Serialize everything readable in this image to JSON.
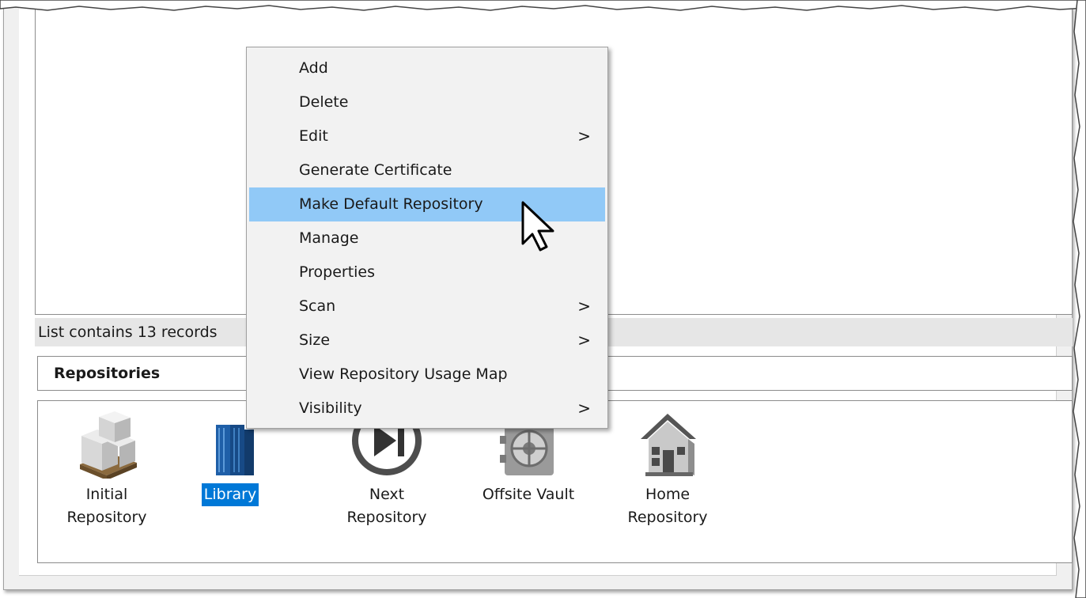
{
  "status_bar": {
    "text": "List contains 13 records"
  },
  "repositories": {
    "header": "Repositories",
    "items": [
      {
        "label": "Initial\nRepository",
        "icon": "boxes-pallet-icon",
        "selected": false
      },
      {
        "label": "Library",
        "icon": "server-rack-icon",
        "selected": true
      },
      {
        "label": "Next Repository",
        "icon": "next-track-icon",
        "selected": false
      },
      {
        "label": "Offsite Vault",
        "icon": "vault-icon",
        "selected": false
      },
      {
        "label": "Home\nRepository",
        "icon": "house-icon",
        "selected": false
      }
    ]
  },
  "context_menu": {
    "items": [
      {
        "label": "Add",
        "submenu": false
      },
      {
        "label": "Delete",
        "submenu": false
      },
      {
        "label": "Edit",
        "submenu": true
      },
      {
        "label": "Generate Certificate",
        "submenu": false
      },
      {
        "label": "Make Default Repository",
        "submenu": false,
        "highlighted": true
      },
      {
        "label": "Manage",
        "submenu": false
      },
      {
        "label": "Properties",
        "submenu": false
      },
      {
        "label": "Scan",
        "submenu": true
      },
      {
        "label": "Size",
        "submenu": true
      },
      {
        "label": "View Repository Usage Map",
        "submenu": false
      },
      {
        "label": "Visibility",
        "submenu": true
      }
    ],
    "submenu_glyph": ">"
  },
  "colors": {
    "selection": "#0078d7",
    "menu_highlight": "#91c9f7",
    "menu_background": "#f2f2f2"
  }
}
